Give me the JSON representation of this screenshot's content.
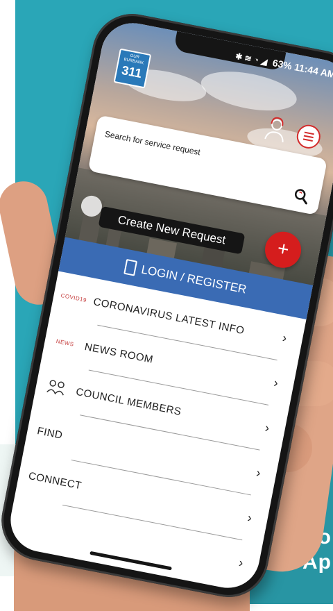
{
  "status_bar": {
    "icons": "✱ ≋ ◔ ◢",
    "battery": "63%",
    "time": "11:44 AM"
  },
  "logo": {
    "small_text": "OUR BURBANK",
    "number": "311"
  },
  "search": {
    "placeholder": "Search for service request",
    "icon": "search-icon"
  },
  "create_request": {
    "label": "Create New Request",
    "plus": "+"
  },
  "login": {
    "label": "LOGIN / REGISTER",
    "icon": "door-icon"
  },
  "menu": [
    {
      "label": "CORONAVIRUS LATEST INFO",
      "icon_text": "COVID19",
      "chevron": "›"
    },
    {
      "label": "NEWS ROOM",
      "icon_text": "NEWS",
      "chevron": "›"
    },
    {
      "label": "COUNCIL MEMBERS",
      "icon_text": "",
      "chevron": "›"
    },
    {
      "label": "FIND",
      "icon_text": "",
      "chevron": "›"
    },
    {
      "label": "CONNECT",
      "icon_text": "",
      "chevron": "›"
    },
    {
      "label": "",
      "icon_text": "",
      "chevron": "›"
    }
  ],
  "promo": {
    "line1": "Do",
    "line2": "Ap"
  },
  "colors": {
    "teal": "#2aa6b7",
    "login_blue": "#3a6bb4",
    "accent_red": "#d51d1d"
  }
}
